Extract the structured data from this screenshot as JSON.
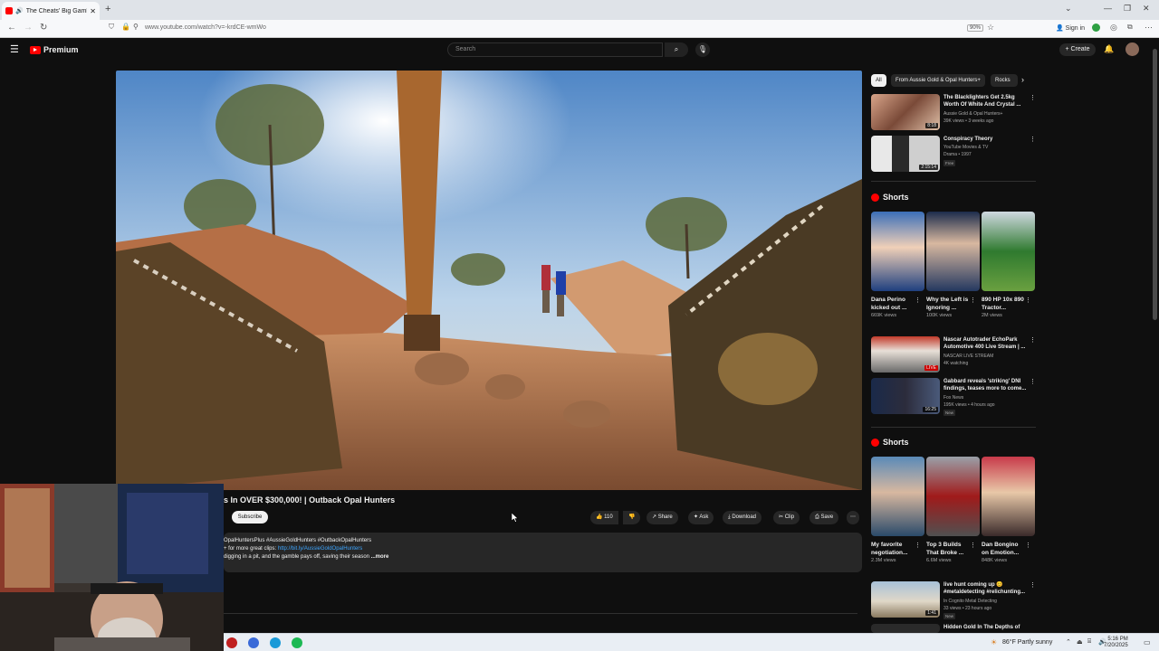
{
  "browser": {
    "tab_title": "The Cheats' Big Gamble Bri",
    "url": "www.youtube.com/watch?v=-krdCE-wmWo",
    "zoom": "90%",
    "signin": "Sign in"
  },
  "masthead": {
    "brand": "Premium",
    "search_placeholder": "Search",
    "create": "+ Create"
  },
  "video": {
    "title": "s In OVER $300,000! | Outback Opal Hunters",
    "subscribe": "Subscribe",
    "likes": "110",
    "actions": [
      "Share",
      "Ask",
      "Download",
      "Clip",
      "Save"
    ],
    "desc_tags": "OpalHuntersPlus #AussieGoldHunters #OutbackOpalHunters",
    "desc_line2_prefix": "+ for more great clips: ",
    "desc_link": "http://bit.ly/AussieGoldOpalHunters",
    "desc_line3": "digging in a pit, and the gamble pays off, saving their season",
    "more": "...more"
  },
  "sidebar": {
    "chips": [
      "All",
      "From Aussie Gold & Opal Hunters+",
      "Rocks"
    ],
    "recs_top": [
      {
        "title": "The Blacklighters Get 2.5kg Worth Of White And Crystal ...",
        "channel": "Aussie Gold & Opal Hunters+",
        "meta": "39K views • 3 weeks ago",
        "duration": "8:18"
      },
      {
        "title": "Conspiracy Theory",
        "channel": "YouTube Movies & TV",
        "meta": "Drama • 1997",
        "duration": "2:15:14",
        "badge": "Free"
      }
    ],
    "shorts_label": "Shorts",
    "shorts1": [
      {
        "title": "Dana Perino kicked out ...",
        "views": "669K views"
      },
      {
        "title": "Why the Left is Ignoring ...",
        "views": "100K views"
      },
      {
        "title": "890 HP 10x 890 Tractor...",
        "views": "2M views"
      }
    ],
    "recs_mid": [
      {
        "title": "Nascar Autotrader EchoPark Automotive 400 Live Stream | ...",
        "channel": "NASCAR LIVE STREAM",
        "meta": "4K watching",
        "duration": "LIVE"
      },
      {
        "title": "Gabbard reveals 'striking' DNI findings, teases more to come...",
        "channel": "Fox News",
        "meta": "195K views • 4 hours ago",
        "duration": "16:25",
        "badge": "New"
      }
    ],
    "shorts2": [
      {
        "title": "My favorite negotiation...",
        "views": "2.3M views"
      },
      {
        "title": "Top 3 Builds That Broke ...",
        "views": "6.6M views"
      },
      {
        "title": "Dan Bongino on Emotion...",
        "views": "848K views"
      }
    ],
    "recs_bottom": [
      {
        "title": "live hunt coming up 😊 #metaldetecting #relichunting...",
        "channel": "In Cognito Metal Detecting",
        "meta": "33 views • 23 hours ago",
        "duration": "1:41",
        "badge": "New"
      },
      {
        "title": "Hidden Gold In The Depths of"
      }
    ]
  },
  "taskbar": {
    "weather": "86°F  Partly sunny",
    "time": "5:16 PM",
    "date": "7/20/2025"
  }
}
